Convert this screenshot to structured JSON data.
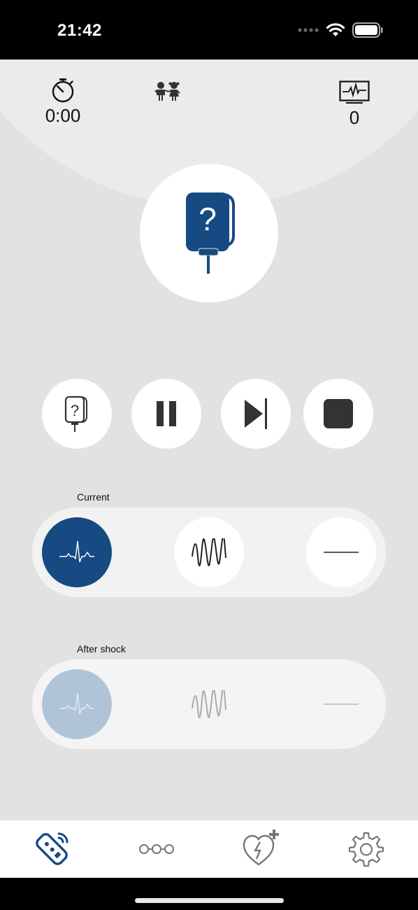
{
  "status_bar": {
    "time": "21:42"
  },
  "header": {
    "timer_value": "0:00",
    "shock_count": "0"
  },
  "controls": {
    "pad_check": "pad-check",
    "pause": "pause",
    "skip": "skip-next",
    "stop": "stop"
  },
  "current": {
    "label": "Current",
    "options": [
      "sinus-rhythm",
      "ventricular-fibrillation",
      "asystole"
    ],
    "selected": "sinus-rhythm"
  },
  "after_shock": {
    "label": "After shock",
    "options": [
      "sinus-rhythm",
      "ventricular-fibrillation",
      "asystole"
    ],
    "selected": "sinus-rhythm"
  },
  "tabs": [
    "remote-icon",
    "scenario-icon",
    "aed-heart-icon",
    "settings-icon"
  ],
  "colors": {
    "accent": "#174a83",
    "accent_faded": "#b0c4d7",
    "background": "#e2e2e2"
  }
}
